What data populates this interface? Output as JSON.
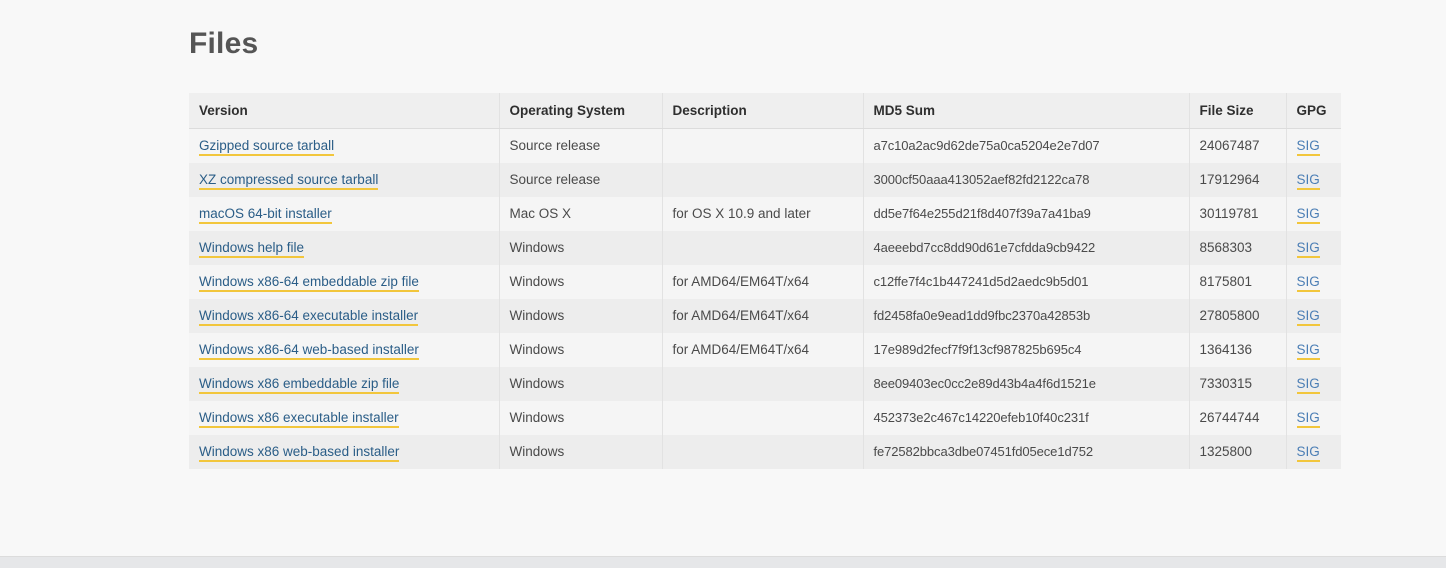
{
  "page": {
    "title": "Files",
    "background_color": "#f8f8f8",
    "link_color": "#2a5d87",
    "link_underline_color": "#f2c63c",
    "sig_link_color": "#4b7eb5"
  },
  "table": {
    "columns": [
      {
        "key": "version",
        "label": "Version"
      },
      {
        "key": "os",
        "label": "Operating System"
      },
      {
        "key": "description",
        "label": "Description"
      },
      {
        "key": "md5",
        "label": "MD5 Sum"
      },
      {
        "key": "size",
        "label": "File Size"
      },
      {
        "key": "gpg",
        "label": "GPG"
      }
    ],
    "gpg_link_label": "SIG",
    "rows": [
      {
        "version": "Gzipped source tarball",
        "os": "Source release",
        "description": "",
        "md5": "a7c10a2ac9d62de75a0ca5204e2e7d07",
        "size": "24067487",
        "gpg": "SIG"
      },
      {
        "version": "XZ compressed source tarball",
        "os": "Source release",
        "description": "",
        "md5": "3000cf50aaa413052aef82fd2122ca78",
        "size": "17912964",
        "gpg": "SIG"
      },
      {
        "version": "macOS 64-bit installer",
        "os": "Mac OS X",
        "description": "for OS X 10.9 and later",
        "md5": "dd5e7f64e255d21f8d407f39a7a41ba9",
        "size": "30119781",
        "gpg": "SIG"
      },
      {
        "version": "Windows help file",
        "os": "Windows",
        "description": "",
        "md5": "4aeeebd7cc8dd90d61e7cfdda9cb9422",
        "size": "8568303",
        "gpg": "SIG"
      },
      {
        "version": "Windows x86-64 embeddable zip file",
        "os": "Windows",
        "description": "for AMD64/EM64T/x64",
        "md5": "c12ffe7f4c1b447241d5d2aedc9b5d01",
        "size": "8175801",
        "gpg": "SIG"
      },
      {
        "version": "Windows x86-64 executable installer",
        "os": "Windows",
        "description": "for AMD64/EM64T/x64",
        "md5": "fd2458fa0e9ead1dd9fbc2370a42853b",
        "size": "27805800",
        "gpg": "SIG"
      },
      {
        "version": "Windows x86-64 web-based installer",
        "os": "Windows",
        "description": "for AMD64/EM64T/x64",
        "md5": "17e989d2fecf7f9f13cf987825b695c4",
        "size": "1364136",
        "gpg": "SIG"
      },
      {
        "version": "Windows x86 embeddable zip file",
        "os": "Windows",
        "description": "",
        "md5": "8ee09403ec0cc2e89d43b4a4f6d1521e",
        "size": "7330315",
        "gpg": "SIG"
      },
      {
        "version": "Windows x86 executable installer",
        "os": "Windows",
        "description": "",
        "md5": "452373e2c467c14220efeb10f40c231f",
        "size": "26744744",
        "gpg": "SIG"
      },
      {
        "version": "Windows x86 web-based installer",
        "os": "Windows",
        "description": "",
        "md5": "fe72582bbca3dbe07451fd05ece1d752",
        "size": "1325800",
        "gpg": "SIG"
      }
    ]
  }
}
